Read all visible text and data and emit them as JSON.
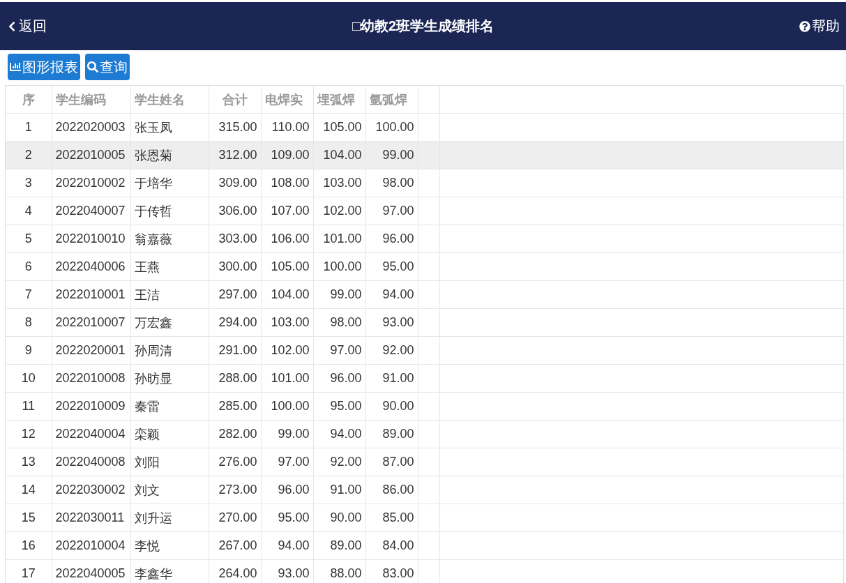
{
  "header": {
    "back": "返回",
    "title": "□幼教2班学生成绩排名",
    "help": "帮助"
  },
  "toolbar": [
    {
      "kind": "chart",
      "label": "图形报表"
    },
    {
      "kind": "search",
      "label": "查询"
    }
  ],
  "table": {
    "columns": [
      "序",
      "学生编码",
      "学生姓名",
      "合计",
      "电焊实",
      "埋弧焊",
      "氩弧焊"
    ],
    "rows": [
      {
        "selected": false,
        "cells": [
          "1",
          "2022020003",
          "张玉凤",
          "315.00",
          "110.00",
          "105.00",
          "100.00"
        ]
      },
      {
        "selected": true,
        "cells": [
          "2",
          "2022010005",
          "张恩菊",
          "312.00",
          "109.00",
          "104.00",
          "99.00"
        ]
      },
      {
        "selected": false,
        "cells": [
          "3",
          "2022010002",
          "于培华",
          "309.00",
          "108.00",
          "103.00",
          "98.00"
        ]
      },
      {
        "selected": false,
        "cells": [
          "4",
          "2022040007",
          "于传哲",
          "306.00",
          "107.00",
          "102.00",
          "97.00"
        ]
      },
      {
        "selected": false,
        "cells": [
          "5",
          "2022010010",
          "翁嘉薇",
          "303.00",
          "106.00",
          "101.00",
          "96.00"
        ]
      },
      {
        "selected": false,
        "cells": [
          "6",
          "2022040006",
          "王燕",
          "300.00",
          "105.00",
          "100.00",
          "95.00"
        ]
      },
      {
        "selected": false,
        "cells": [
          "7",
          "2022010001",
          "王洁",
          "297.00",
          "104.00",
          "99.00",
          "94.00"
        ]
      },
      {
        "selected": false,
        "cells": [
          "8",
          "2022010007",
          "万宏鑫",
          "294.00",
          "103.00",
          "98.00",
          "93.00"
        ]
      },
      {
        "selected": false,
        "cells": [
          "9",
          "2022020001",
          "孙周清",
          "291.00",
          "102.00",
          "97.00",
          "92.00"
        ]
      },
      {
        "selected": false,
        "cells": [
          "10",
          "2022010008",
          "孙昉显",
          "288.00",
          "101.00",
          "96.00",
          "91.00"
        ]
      },
      {
        "selected": false,
        "cells": [
          "11",
          "2022010009",
          "秦雷",
          "285.00",
          "100.00",
          "95.00",
          "90.00"
        ]
      },
      {
        "selected": false,
        "cells": [
          "12",
          "2022040004",
          "栾颖",
          "282.00",
          "99.00",
          "94.00",
          "89.00"
        ]
      },
      {
        "selected": false,
        "cells": [
          "13",
          "2022040008",
          "刘阳",
          "276.00",
          "97.00",
          "92.00",
          "87.00"
        ]
      },
      {
        "selected": false,
        "cells": [
          "14",
          "2022030002",
          "刘文",
          "273.00",
          "96.00",
          "91.00",
          "86.00"
        ]
      },
      {
        "selected": false,
        "cells": [
          "15",
          "2022030011",
          "刘升运",
          "270.00",
          "95.00",
          "90.00",
          "85.00"
        ]
      },
      {
        "selected": false,
        "cells": [
          "16",
          "2022010004",
          "李悦",
          "267.00",
          "94.00",
          "89.00",
          "84.00"
        ]
      },
      {
        "selected": false,
        "cells": [
          "17",
          "2022040005",
          "李鑫华",
          "264.00",
          "93.00",
          "88.00",
          "83.00"
        ]
      }
    ]
  }
}
